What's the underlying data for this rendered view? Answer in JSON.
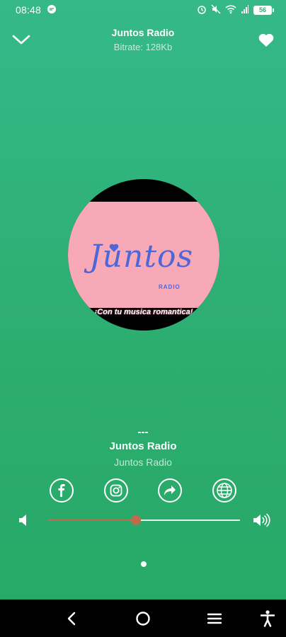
{
  "status_bar": {
    "time": "08:48",
    "battery_level": "56",
    "icons": [
      "chat-bubble-icon",
      "alarm-icon",
      "mute-icon",
      "wifi-icon",
      "signal-icon",
      "battery-icon"
    ]
  },
  "header": {
    "title": "Juntos Radio",
    "bitrate": "Bitrate: 128Kb",
    "left_icon": "chevron-down-icon",
    "right_icon": "heart-icon"
  },
  "artwork": {
    "logo_text": "Juntos",
    "logo_subtext": "RADIO",
    "tagline": "¡Con tu musica romantica!"
  },
  "track": {
    "now_playing": "---",
    "station": "Juntos Radio",
    "subtitle": "Juntos Radio"
  },
  "social": [
    "facebook-icon",
    "instagram-icon",
    "share-icon",
    "website-globe-icon"
  ],
  "volume": {
    "level": 0.46
  },
  "pager": {
    "pages": 1,
    "current": 1
  },
  "nav_bar": [
    "back-icon",
    "home-icon",
    "recents-icon",
    "accessibility-icon"
  ],
  "colors": {
    "background": "#2eaf73",
    "slider_accent": "#c26a4f",
    "logo_blue": "#4f67d6",
    "art_pink": "#f7a9b8"
  }
}
